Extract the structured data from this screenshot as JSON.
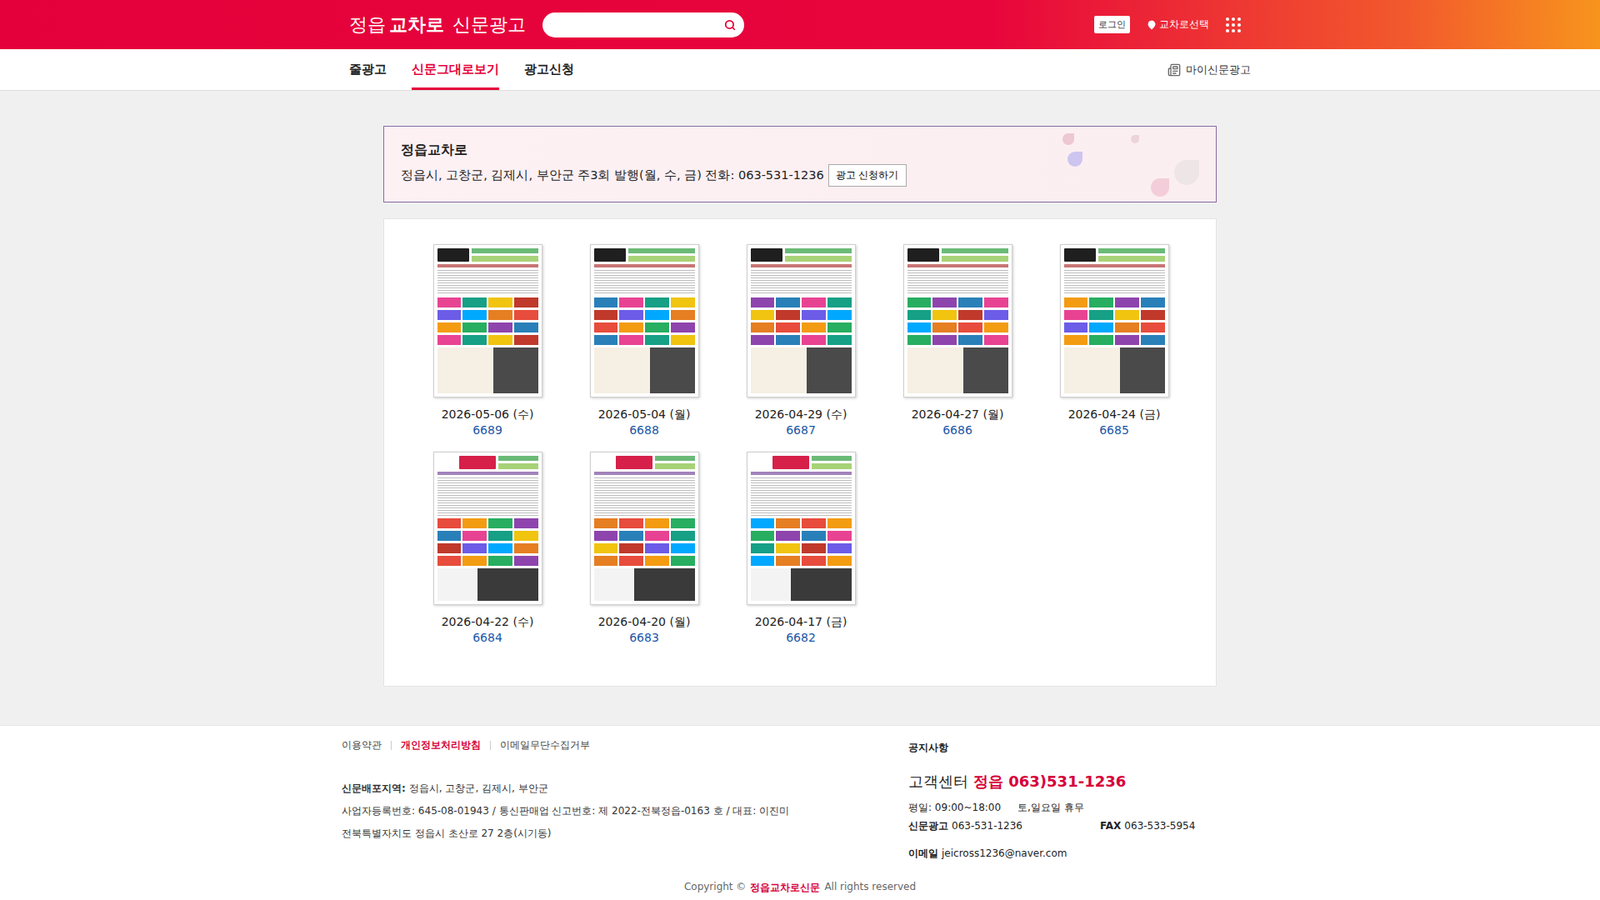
{
  "header": {
    "logo": {
      "region": "정읍",
      "brand": "교차로",
      "service": "신문광고"
    },
    "login": "로그인",
    "region_select": "교차로선택"
  },
  "nav": {
    "tabs": [
      {
        "label": "줄광고",
        "selected": false
      },
      {
        "label": "신문그대로보기",
        "selected": true
      },
      {
        "label": "광고신청",
        "selected": false
      }
    ],
    "my_ads": "마이신문광고"
  },
  "paper_info": {
    "title": "정읍교차로",
    "description": "정읍시, 고창군, 김제시, 부안군 주3회 발행(월, 수, 금) 전화: 063-531-1236",
    "button": "광고 신청하기"
  },
  "issues": [
    {
      "date": "2026-05-06 (수)",
      "number": "6689",
      "kind": "classic"
    },
    {
      "date": "2026-05-04 (월)",
      "number": "6688",
      "kind": "classic"
    },
    {
      "date": "2026-04-29 (수)",
      "number": "6687",
      "kind": "classic"
    },
    {
      "date": "2026-04-27 (월)",
      "number": "6686",
      "kind": "classic"
    },
    {
      "date": "2026-04-24 (금)",
      "number": "6685",
      "kind": "classic"
    },
    {
      "date": "2026-04-22 (수)",
      "number": "6684",
      "kind": "red"
    },
    {
      "date": "2026-04-20 (월)",
      "number": "6683",
      "kind": "red"
    },
    {
      "date": "2026-04-17 (금)",
      "number": "6682",
      "kind": "red"
    }
  ],
  "footer": {
    "links": [
      {
        "label": "이용약관",
        "highlight": false
      },
      {
        "label": "개인정보처리방침",
        "highlight": true
      },
      {
        "label": "이메일무단수집거부",
        "highlight": false
      }
    ],
    "info": [
      {
        "label": "신문배포지역:",
        "value": "정읍시, 고창군, 김제시, 부안군"
      },
      {
        "label": "",
        "value": "사업자등록번호: 645-08-01943 / 통신판매업 신고번호: 제 2022-전북정읍-0163 호 / 대표: 이진미"
      },
      {
        "label": "",
        "value": "전북특별자치도 정읍시 초산로 27 2층(시기동)"
      }
    ],
    "notice_title": "공지사항",
    "support": {
      "label": "고객센터",
      "region": "정읍",
      "phone": "063)531-1236"
    },
    "hours": "평일: 09:00~18:00",
    "closed": "토,일요일 휴무",
    "contacts": [
      {
        "label": "신문광고",
        "value": "063-531-1236"
      },
      {
        "label": "FAX",
        "value": "063-533-5954"
      }
    ],
    "email": {
      "label": "이메일",
      "value": "jeicross1236@naver.com"
    },
    "copyright": {
      "prefix": "Copyright ©",
      "brand": "정읍교차로신문",
      "suffix": "All rights reserved"
    }
  }
}
